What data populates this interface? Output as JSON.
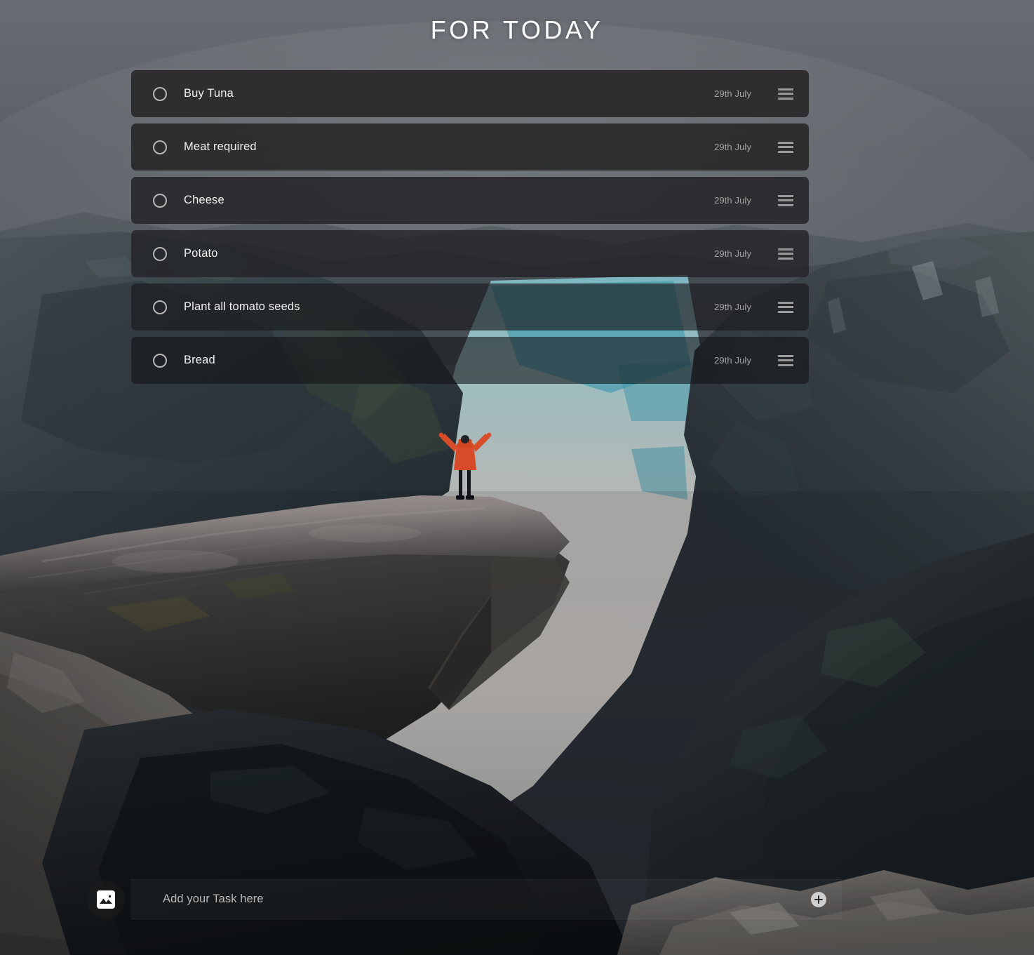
{
  "header": {
    "title": "FOR TODAY"
  },
  "theme": {
    "card_dark": "#2d2d30",
    "text_primary": "#f2f2f2",
    "text_muted": "#a3a3a3",
    "accent_jacket": "#e2502a",
    "sky": "#575c61"
  },
  "tasks": [
    {
      "label": "Buy Tuna",
      "date": "29th July",
      "checked": false,
      "checkbox_icon": "circle-outline-icon",
      "menu_icon": "hamburger-menu-icon"
    },
    {
      "label": "Meat required",
      "date": "29th July",
      "checked": false,
      "checkbox_icon": "circle-outline-icon",
      "menu_icon": "hamburger-menu-icon"
    },
    {
      "label": "Cheese",
      "date": "29th July",
      "checked": false,
      "checkbox_icon": "circle-outline-icon",
      "menu_icon": "hamburger-menu-icon"
    },
    {
      "label": "Potato",
      "date": "29th July",
      "checked": false,
      "checkbox_icon": "circle-outline-icon",
      "menu_icon": "hamburger-menu-icon"
    },
    {
      "label": "Plant all tomato seeds",
      "date": "29th July",
      "checked": false,
      "checkbox_icon": "circle-outline-icon",
      "menu_icon": "hamburger-menu-icon"
    },
    {
      "label": "Bread",
      "date": "29th July",
      "checked": false,
      "checkbox_icon": "circle-outline-icon",
      "menu_icon": "hamburger-menu-icon"
    }
  ],
  "add_bar": {
    "placeholder": "Add your Task here",
    "value": "",
    "add_icon": "plus-icon",
    "image_icon": "image-picker-icon"
  },
  "background": {
    "scene": "mountain-fjord-cliff-photo",
    "subject": "person-standing-on-cliff"
  }
}
